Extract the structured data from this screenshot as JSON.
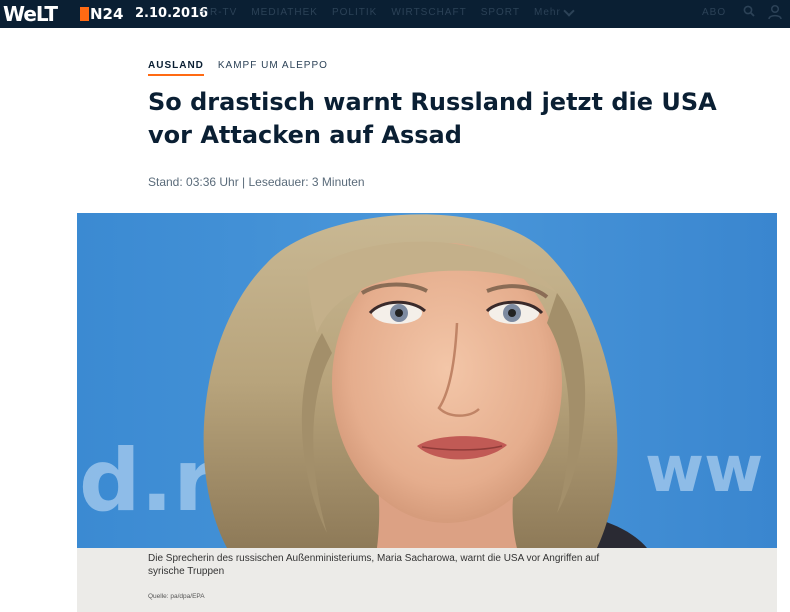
{
  "header": {
    "logo": "WeLT",
    "logo_partner": "N24",
    "date": "2.10.2016",
    "nav": [
      "Hir-TV",
      "Mediathek",
      "Politik",
      "Wirtschaft",
      "Sport"
    ],
    "more_label": "Mehr",
    "abo_label": "ABO",
    "icons": [
      "search-icon",
      "user-icon"
    ]
  },
  "article": {
    "rubric": "AUSLAND",
    "topic": "KAMPF UM ALEPPO",
    "headline_line1": "So drastisch warnt Russland jetzt die USA",
    "headline_line2": "vor Attacken auf Assad",
    "meta": "Stand: 03:36 Uhr | Lesedauer: 3 Minuten",
    "caption_line1": "Die Sprecherin des russischen Außenministeriums, Maria Sacharowa, warnt die USA vor Angriffen auf",
    "caption_line2": "syrische Truppen",
    "credit": "Quelle: pa/dpa/EPA"
  },
  "colors": {
    "topbar": "#0a1f33",
    "accent": "#ff6a13",
    "headline": "#0a1f33",
    "caption_bg": "#ecebe8"
  }
}
